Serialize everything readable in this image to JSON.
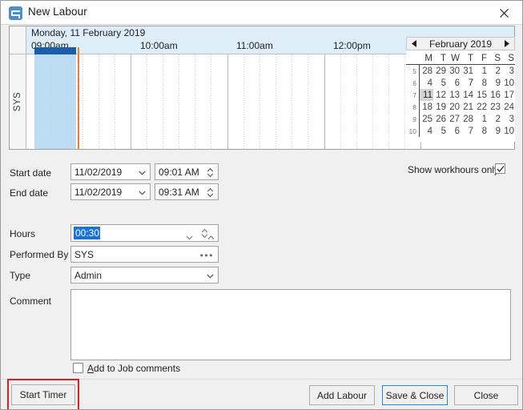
{
  "window": {
    "title": "New Labour",
    "icon": "app-icon",
    "close_label": "×"
  },
  "scheduler": {
    "resource_label": "SYS",
    "date_header": "Monday, 11 February 2019",
    "hour_ticks": [
      "09:00am",
      "10:00am",
      "11:00am",
      "12:00pm"
    ],
    "selection_start": "09:00am",
    "selection_end": "09:30am",
    "now_marker": "09:31am",
    "selection_color": "#1d5ea8",
    "selection_band_color": "#bcdcf4",
    "now_marker_color": "#ed7d31",
    "header_bg": "#ddeef8"
  },
  "mini_calendar": {
    "title": "February 2019",
    "prev_label": "◄",
    "next_label": "►",
    "weekday_headers": [
      "M",
      "T",
      "W",
      "T",
      "F",
      "S",
      "S"
    ],
    "week_numbers": [
      5,
      6,
      7,
      8,
      9,
      10
    ],
    "weeks": [
      [
        28,
        29,
        30,
        31,
        1,
        2,
        3
      ],
      [
        4,
        5,
        6,
        7,
        8,
        9,
        10
      ],
      [
        11,
        12,
        13,
        14,
        15,
        16,
        17
      ],
      [
        18,
        19,
        20,
        21,
        22,
        23,
        24
      ],
      [
        25,
        26,
        27,
        28,
        1,
        2,
        3
      ],
      [
        4,
        5,
        6,
        7,
        8,
        9,
        10
      ]
    ],
    "selected_day": 11,
    "selected_week_index": 2,
    "selected_col_index": 0,
    "today_day": 7,
    "today_week_index": 1,
    "today_col_index": 3
  },
  "options": {
    "show_workhours_label": "Show workhours only",
    "show_workhours_checked": true,
    "add_to_job_comments_label_prefix": "A",
    "add_to_job_comments_label_rest": "dd to Job comments",
    "add_to_job_comments_checked": false
  },
  "form": {
    "start_date_label": "Start date",
    "start_date_value": "11/02/2019",
    "start_time_value": "09:01 AM",
    "end_date_label": "End date",
    "end_date_value": "11/02/2019",
    "end_time_value": "09:31 AM",
    "hours_label": "Hours",
    "hours_value": "00:30",
    "performed_by_label": "Performed By",
    "performed_by_value": "SYS",
    "performed_by_browse": "…",
    "type_label": "Type",
    "type_value": "Admin",
    "comment_label": "Comment",
    "comment_value": ""
  },
  "footer": {
    "start_timer_label": "Start Timer",
    "add_labour_label": "Add Labour",
    "save_close_label": "Save & Close",
    "close_label": "Close",
    "highlight_color": "#e02020",
    "focus_color": "#1f8ae0"
  }
}
